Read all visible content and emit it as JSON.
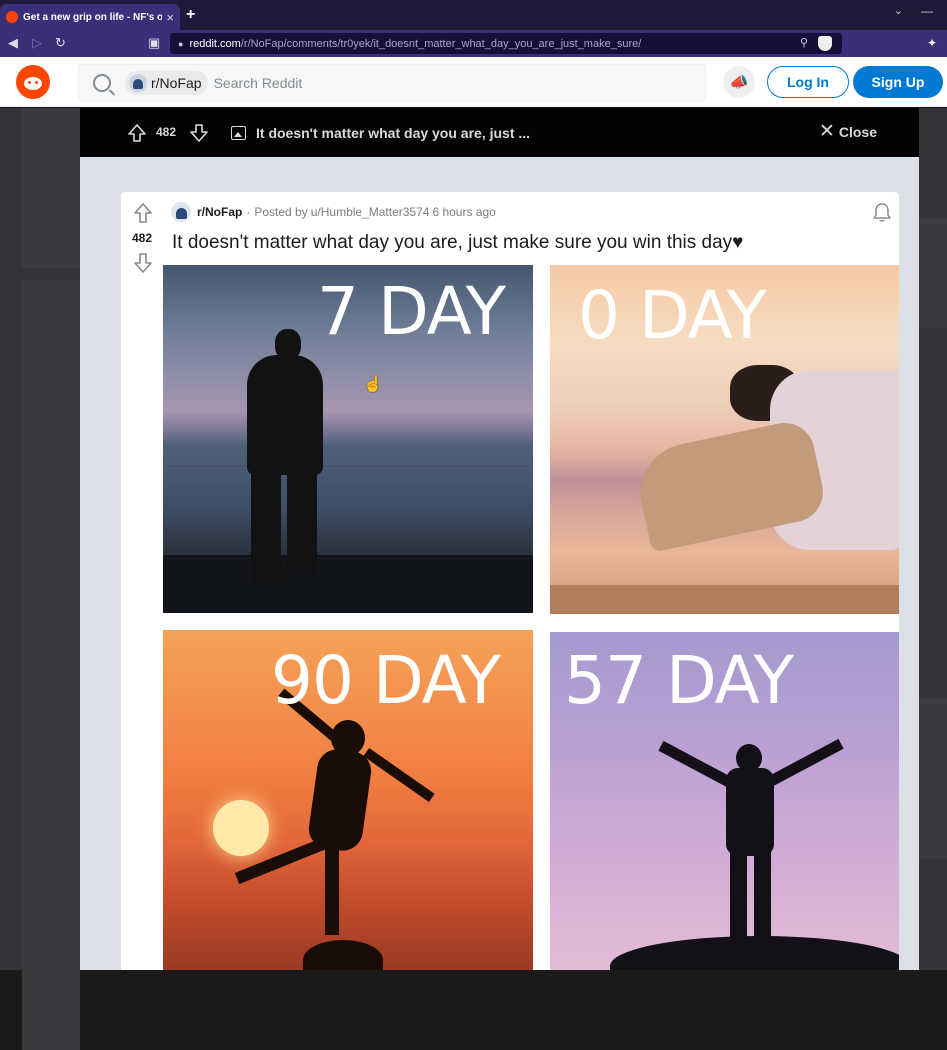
{
  "browser": {
    "tab_title": "Get a new grip on life - NF's offici",
    "tab_close": "×",
    "new_tab": "+",
    "url_host": "reddit.com",
    "url_path": "/r/NoFap/comments/tr0yek/it_doesnt_matter_what_day_you_are_just_make_sure/"
  },
  "header": {
    "subreddit_chip": "r/NoFap",
    "search_placeholder": "Search Reddit",
    "login_label": "Log In",
    "signup_label": "Sign Up"
  },
  "post_bar": {
    "score": "482",
    "title": "It doesn't matter what day you are, just ...",
    "close_label": "Close"
  },
  "post": {
    "score": "482",
    "subreddit": "r/NoFap",
    "separator": "·",
    "posted_by": "Posted by",
    "author": "u/Humble_Matter3574",
    "time": "6 hours ago",
    "title": "It doesn't matter what day you are, just make sure you win this day♥"
  },
  "image": {
    "panels": [
      {
        "label": "7 DAY"
      },
      {
        "label": "0 DAY"
      },
      {
        "label": "90 DAY"
      },
      {
        "label": "57 DAY"
      }
    ]
  },
  "colors": {
    "reddit_orange": "#ff4500",
    "reddit_blue": "#0079d3",
    "browser_purple": "#3b2f7a"
  },
  "icons": [
    "reddit-logo-icon",
    "search-icon",
    "advertise-icon",
    "upvote-icon",
    "downvote-icon",
    "image-icon",
    "close-icon",
    "bell-icon"
  ]
}
